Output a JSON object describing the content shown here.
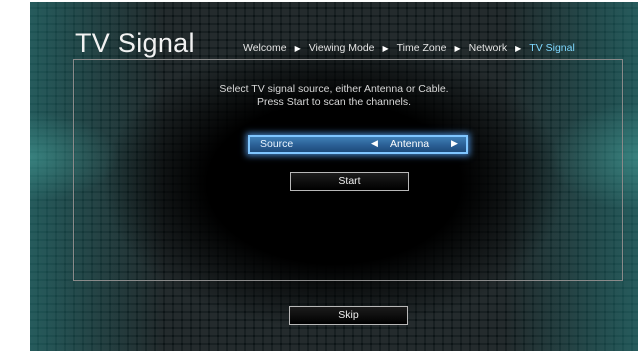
{
  "header": {
    "title": "TV Signal"
  },
  "breadcrumb": {
    "items": [
      "Welcome",
      "Viewing Mode",
      "Time Zone",
      "Network",
      "TV Signal"
    ],
    "separator": "▶",
    "current_index": 4
  },
  "instruction": {
    "line1": "Select TV signal source, either Antenna or Cable.",
    "line2": "Press Start to scan the channels."
  },
  "source_selector": {
    "label": "Source",
    "value": "Antenna",
    "prev_arrow": "◀",
    "next_arrow": "▶"
  },
  "buttons": {
    "start_label": "Start",
    "skip_label": "Skip"
  },
  "colors": {
    "accent": "#7fd8ff",
    "focus_fill": "#2a5f95",
    "focus_border": "#7fc6ff",
    "background": "#0c1416"
  },
  "icons": {
    "separator": "triangle-right-icon",
    "prev": "triangle-left-icon",
    "next": "triangle-right-icon"
  }
}
